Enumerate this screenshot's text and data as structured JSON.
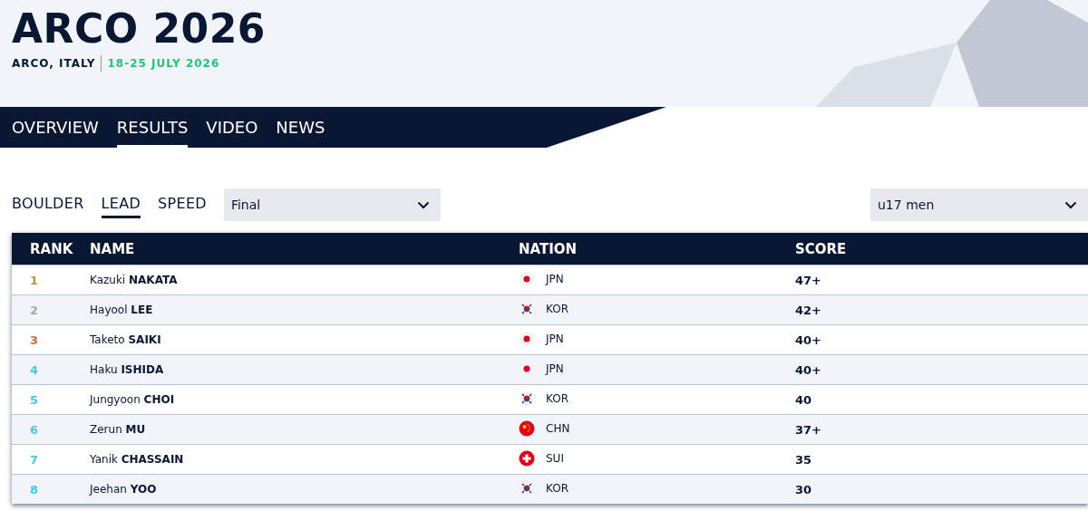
{
  "event": {
    "title": "ARCO 2026",
    "location": "ARCO, ITALY",
    "dates": "18-25  JULY 2026"
  },
  "nav_tabs": [
    {
      "label": "OVERVIEW",
      "selected": false
    },
    {
      "label": "RESULTS",
      "selected": true
    },
    {
      "label": "VIDEO",
      "selected": false
    },
    {
      "label": "NEWS",
      "selected": false
    }
  ],
  "discipline_tabs": [
    {
      "label": "BOULDER",
      "selected": false
    },
    {
      "label": "LEAD",
      "selected": true
    },
    {
      "label": "SPEED",
      "selected": false
    }
  ],
  "round_select": {
    "value": "Final"
  },
  "category_select": {
    "value": "u17 men"
  },
  "table": {
    "columns": [
      "RANK",
      "NAME",
      "NATION",
      "SCORE"
    ],
    "rows": [
      {
        "rank": "1",
        "color": "#b59a3c",
        "name": "Kazuki **NAKATA**",
        "kind": "jp",
        "nation": "JPN",
        "score": "47+"
      },
      {
        "rank": "2",
        "color": "#a8a8a8",
        "name": "Hayool **LEE**",
        "kind": "kr",
        "nation": "KOR",
        "score": "42+"
      },
      {
        "rank": "3",
        "color": "#c8703c",
        "name": "Taketo **SAIKI**",
        "kind": "jp",
        "nation": "JPN",
        "score": "40+"
      },
      {
        "rank": "4",
        "color": "#4fc3e8",
        "name": "Haku **ISHIDA**",
        "kind": "jp",
        "nation": "JPN",
        "score": "40+"
      },
      {
        "rank": "5",
        "color": "#4fc3e8",
        "name": "Jungyoon **CHOI**",
        "kind": "kr",
        "nation": "KOR",
        "score": "40"
      },
      {
        "rank": "6",
        "color": "#4fc3e8",
        "name": "Zerun **MU**",
        "kind": "cn",
        "nation": "CHN",
        "score": "37+"
      },
      {
        "rank": "7",
        "color": "#4fc3e8",
        "name": "Yanik **CHASSAIN**",
        "kind": "ch",
        "nation": "SUI",
        "score": "35"
      },
      {
        "rank": "8",
        "color": "#4fc3e8",
        "name": "Jeehan **YOO**",
        "kind": "kr",
        "nation": "KOR",
        "score": "30"
      }
    ]
  }
}
